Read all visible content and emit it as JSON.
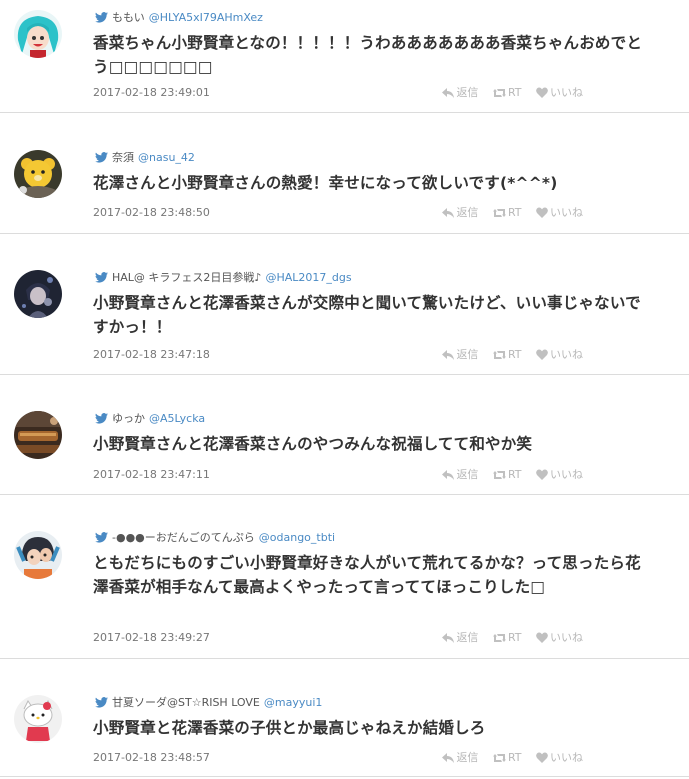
{
  "colors": {
    "accent": "#4a8ac4",
    "action": "#b8b8b8",
    "divider": "#dcdcdc"
  },
  "action_labels": {
    "reply": "返信",
    "retweet": "RT",
    "like": "いいね"
  },
  "tweets": [
    {
      "name": "ももい",
      "handle": "@HLYA5xI79AHmXez",
      "text": "香菜ちゃん小野賢章となの！！！！！うわあああああああ香菜ちゃんおめでとう□□□□□□□",
      "time": "2017-02-18 23:49:01",
      "avatar_icon": "anime-girl-cyan-hair-avatar"
    },
    {
      "name": "奈須",
      "handle": "@nasu_42",
      "text": "花澤さんと小野賢章さんの熱愛！幸せになって欲しいです(*^^*)",
      "time": "2017-02-18 23:48:50",
      "avatar_icon": "plush-bear-avatar"
    },
    {
      "name": "HAL@ キラフェス2日目参戦♪",
      "handle": "@HAL2017_dgs",
      "text": "小野賢章さんと花澤香菜さんが交際中と聞いて驚いたけど、いい事じゃないですかっ！！",
      "time": "2017-02-18 23:47:18",
      "avatar_icon": "dark-character-avatar"
    },
    {
      "name": "ゆっか",
      "handle": "@A5Lycka",
      "text": "小野賢章さんと花澤香菜さんのやつみんな祝福してて和やか笑",
      "time": "2017-02-18 23:47:11",
      "avatar_icon": "food-photo-avatar"
    },
    {
      "name": "-●●●ーおだんごのてんぷら",
      "handle": "@odango_tbti",
      "text": "ともだちにものすごい小野賢章好きな人がいて荒れてるかな？って思ったら花澤香菜が相手なんて最高よくやったって言っててほっこりした□",
      "time": "2017-02-18 23:49:27",
      "avatar_icon": "splatoon-squid-avatar"
    },
    {
      "name": "甘夏ソーダ@ST☆RISH LOVE",
      "handle": "@mayyui1",
      "text": "小野賢章と花澤香菜の子供とか最高じゃねえか結婚しろ",
      "time": "2017-02-18 23:48:57",
      "avatar_icon": "hello-kitty-avatar"
    }
  ]
}
